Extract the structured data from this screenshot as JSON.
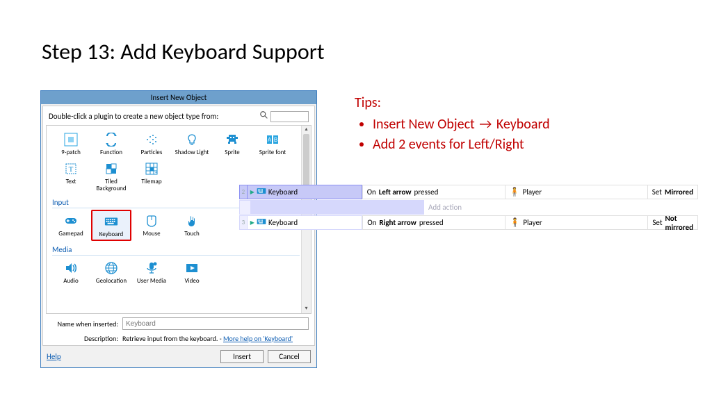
{
  "slide": {
    "title": "Step 13: Add Keyboard Support"
  },
  "tips": {
    "heading": "Tips:",
    "items": [
      {
        "pre": "Insert New Object ",
        "arrow": "→",
        "post": " Keyboard"
      },
      {
        "pre": "Add 2 events for Left/Right",
        "arrow": "",
        "post": ""
      }
    ]
  },
  "dialog": {
    "title": "Insert New Object",
    "subheading": "Double-click a plugin to create a new object type from:",
    "search_placeholder": "",
    "categories": [
      {
        "label": "",
        "items": [
          "9-patch",
          "Function",
          "Particles",
          "Shadow Light",
          "Sprite",
          "Sprite font",
          "Text",
          "Tiled Background",
          "Tilemap"
        ]
      },
      {
        "label": "Input",
        "items": [
          "Gamepad",
          "Keyboard",
          "Mouse",
          "Touch"
        ]
      },
      {
        "label": "Media",
        "items": [
          "Audio",
          "Geolocation",
          "User Media",
          "Video"
        ]
      }
    ],
    "selected": "Keyboard",
    "name_label": "Name when inserted:",
    "name_value": "Keyboard",
    "desc_label": "Description:",
    "desc_text": "Retrieve input from the keyboard. - ",
    "desc_link": "More help on 'Keyboard'",
    "help": "Help",
    "insert": "Insert",
    "cancel": "Cancel"
  },
  "events": {
    "rows": [
      {
        "num": "2",
        "obj": "Keyboard",
        "cond_pre": "On ",
        "cond_b": "Left arrow",
        "cond_post": " pressed",
        "target": "Player",
        "act_pre": "Set ",
        "act_b": "Mirrored"
      },
      {
        "num": "",
        "addaction": "Add action"
      },
      {
        "num": "3",
        "obj": "Keyboard",
        "cond_pre": "On ",
        "cond_b": "Right arrow",
        "cond_post": " pressed",
        "target": "Player",
        "act_pre": "Set ",
        "act_b": "Not mirrored"
      }
    ]
  }
}
